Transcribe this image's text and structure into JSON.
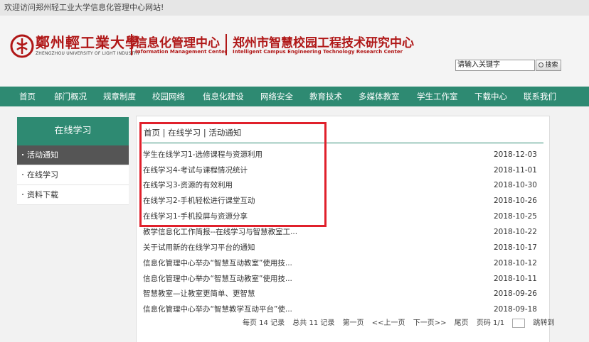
{
  "topbar": {
    "welcome": "欢迎访问郑州轻工业大学信息化管理中心网站!"
  },
  "header": {
    "univ_cn": "鄭州輕工業大學",
    "univ_en": "ZHENGZHOU UNIVERSITY OF LIGHT INDUSTRY",
    "imc_cn": "信息化管理中心",
    "imc_en": "Information Management Center",
    "ice_cn": "郑州市智慧校园工程技术研究中心",
    "ice_en": "Intelligent Campus Engineering Technology Research Center",
    "search_value": "请输入关键字",
    "search_button": "搜索"
  },
  "nav": [
    "首页",
    "部门概况",
    "规章制度",
    "校园网络",
    "信息化建设",
    "网络安全",
    "教育技术",
    "多媒体教室",
    "学生工作室",
    "下载中心",
    "联系我们"
  ],
  "sidebar": {
    "title": "在线学习",
    "items": [
      "活动通知",
      "在线学习",
      "资料下载"
    ]
  },
  "breadcrumb": "首页 | 在线学习 | 活动通知",
  "list": [
    {
      "title": "学生在线学习1-选修课程与资源利用",
      "date": "2018-12-03"
    },
    {
      "title": "在线学习4-考试与课程情况统计",
      "date": "2018-11-01"
    },
    {
      "title": "在线学习3-资源的有效利用",
      "date": "2018-10-30"
    },
    {
      "title": "在线学习2-手机轻松进行课堂互动",
      "date": "2018-10-26"
    },
    {
      "title": "在线学习1-手机投屏与资源分享",
      "date": "2018-10-25"
    },
    {
      "title": "教学信息化工作简报--在线学习与智慧教室工...",
      "date": "2018-10-22"
    },
    {
      "title": "关于试用新的在线学习平台的通知",
      "date": "2018-10-17"
    },
    {
      "title": "信息化管理中心举办“智慧互动教室”使用技...",
      "date": "2018-10-12"
    },
    {
      "title": "信息化管理中心举办“智慧互动教室”使用技...",
      "date": "2018-10-11"
    },
    {
      "title": "智慧教室—让教室更简单、更智慧",
      "date": "2018-09-26"
    },
    {
      "title": "信息化管理中心举办“智慧教学互动平台”使...",
      "date": "2018-09-18"
    }
  ],
  "pager": {
    "per_page": "每页 14 记录",
    "total": "总共 11 记录",
    "first": "第一页",
    "prev": "<<上一页",
    "next": "下一页>>",
    "last": "尾页",
    "page_info": "页码 1/1",
    "jump": "跳转到"
  },
  "colors": {
    "brand_red": "#b01717",
    "nav_green": "#2e8a72",
    "highlight": "#e0202b"
  }
}
